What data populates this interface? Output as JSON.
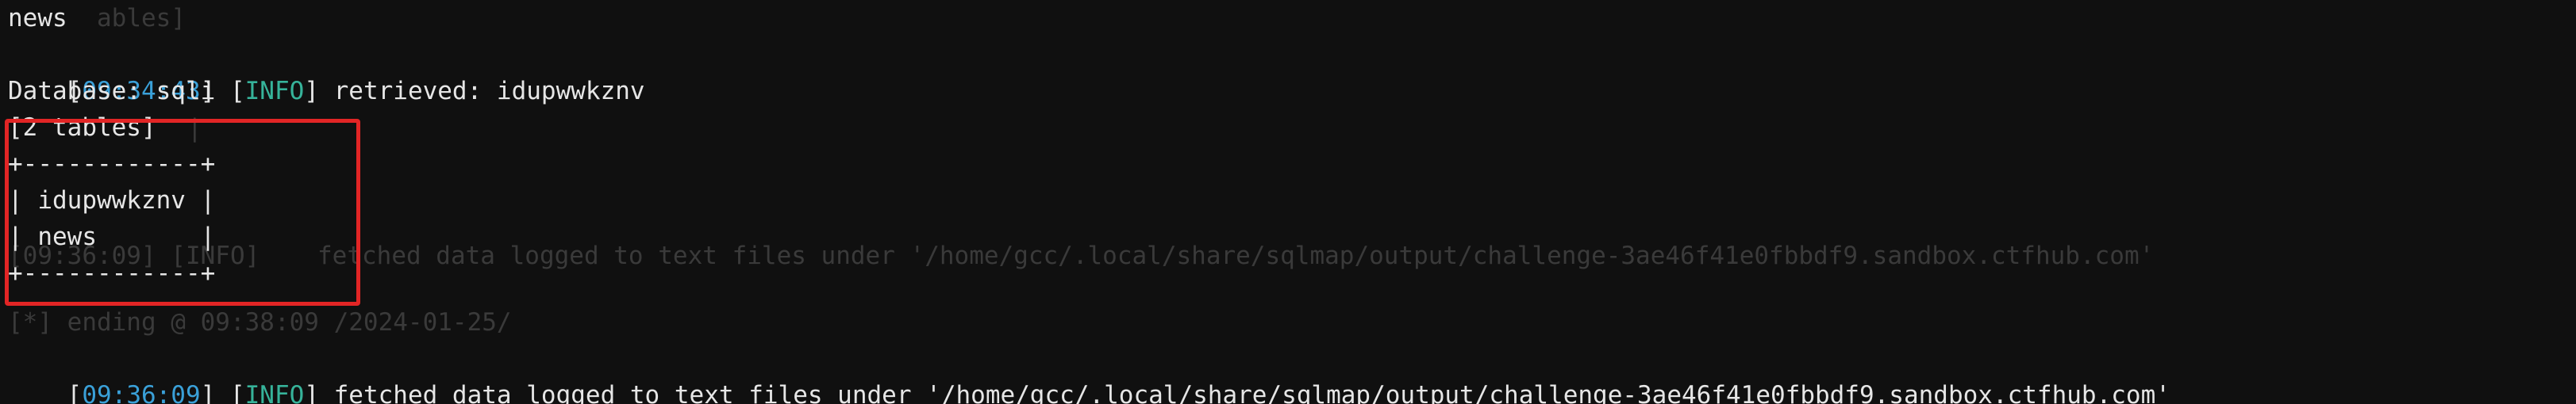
{
  "terminal": {
    "ghost": {
      "tables_tail": "ables]",
      "repeat_prefix": "[09:36:09] [INFO] ",
      "ending_line": "[*] ending @ 09:38:09 /2024-01-25/"
    },
    "lines": {
      "news": "news",
      "retrieved": {
        "bracket_open": "[",
        "time": "09:34:43",
        "bracket_mid": "] [",
        "level": "INFO",
        "message": "] retrieved: idupwwkznv"
      },
      "database": "Database: sqli",
      "table_count": "[2 tables]",
      "table_top": "+------------+",
      "row1": "| idupwwkznv |",
      "row2": "| news       |",
      "table_bottom": "+------------+",
      "fetched": {
        "bracket_open": "[",
        "time": "09:36:09",
        "bracket_mid": "] [",
        "level": "INFO",
        "message": "] fetched data logged to text files under '/home/gcc/.local/share/sqlmap/output/challenge-3ae46f41e0fbbdf9.sandbox.ctfhub.com'"
      }
    },
    "colors": {
      "background": "#101010",
      "timestamp": "#3aa0d8",
      "info": "#36b39a",
      "highlight": "#e22525"
    }
  }
}
